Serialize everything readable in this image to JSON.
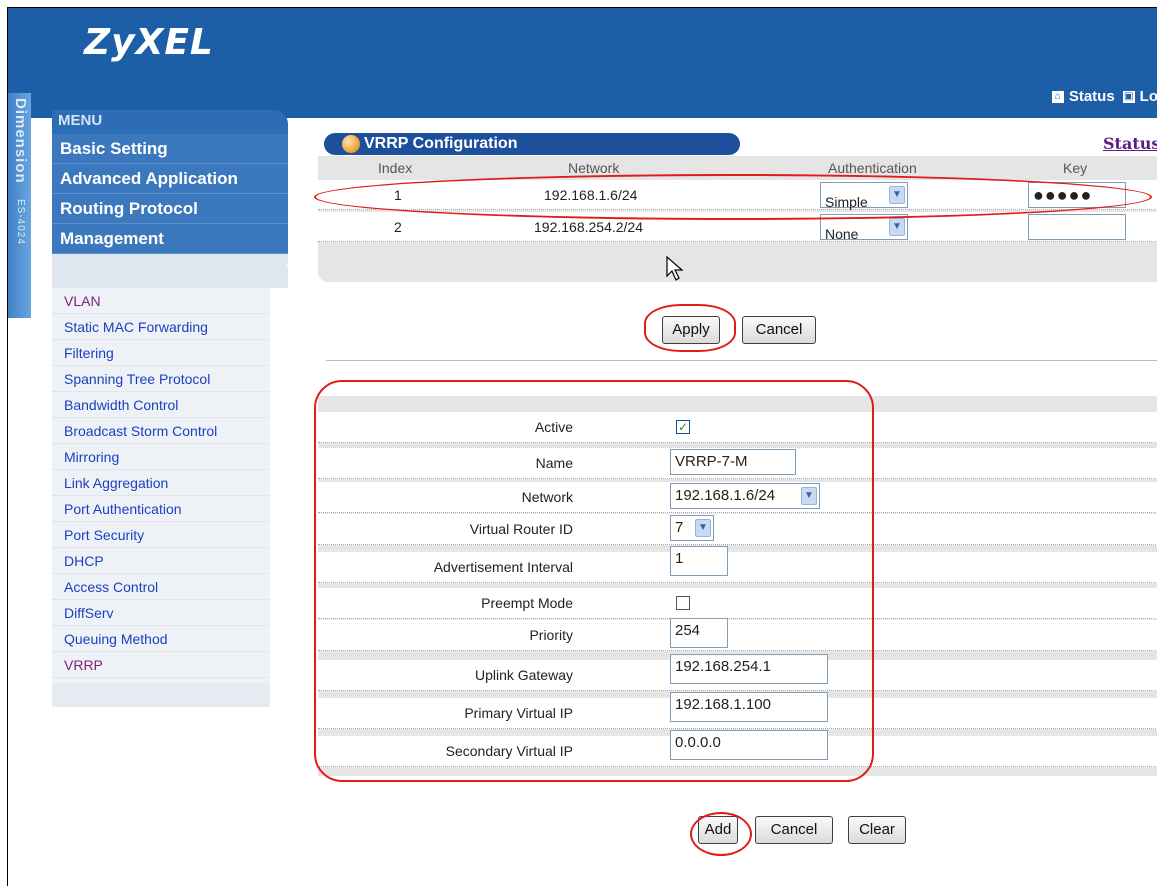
{
  "header": {
    "logo": "ZyXEL",
    "vertical_brand": "Dimension",
    "model": "ES-4024",
    "links": [
      {
        "label": "Status",
        "icon": "home-icon"
      },
      {
        "label": "Lo",
        "icon": "logout-icon"
      }
    ]
  },
  "menu": {
    "title": "MENU",
    "items": [
      {
        "label": "Basic Setting"
      },
      {
        "label": "Advanced Application"
      },
      {
        "label": "Routing Protocol"
      },
      {
        "label": "Management"
      }
    ],
    "sub_items": [
      {
        "label": "VLAN"
      },
      {
        "label": "Static MAC Forwarding"
      },
      {
        "label": "Filtering"
      },
      {
        "label": "Spanning Tree Protocol"
      },
      {
        "label": "Bandwidth Control"
      },
      {
        "label": "Broadcast Storm Control"
      },
      {
        "label": "Mirroring"
      },
      {
        "label": "Link Aggregation"
      },
      {
        "label": "Port Authentication"
      },
      {
        "label": "Port Security"
      },
      {
        "label": "DHCP"
      },
      {
        "label": "Access Control"
      },
      {
        "label": "DiffServ"
      },
      {
        "label": "Queuing Method"
      },
      {
        "label": "VRRP"
      }
    ]
  },
  "section": {
    "title": "VRRP Configuration",
    "status_link": "Status"
  },
  "table": {
    "headers": [
      "Index",
      "Network",
      "Authentication",
      "Key"
    ],
    "rows": [
      {
        "index": "1",
        "network": "192.168.1.6/24",
        "auth": "Simple",
        "key": "●●●●●"
      },
      {
        "index": "2",
        "network": "192.168.254.2/24",
        "auth": "None",
        "key": ""
      }
    ]
  },
  "actions_top": {
    "apply": "Apply",
    "cancel": "Cancel"
  },
  "form": {
    "active_label": "Active",
    "active_checked": true,
    "name_label": "Name",
    "name_value": "VRRP-7-M",
    "network_label": "Network",
    "network_value": "192.168.1.6/24",
    "vrid_label": "Virtual Router ID",
    "vrid_value": "7",
    "adv_label": "Advertisement Interval",
    "adv_value": "1",
    "preempt_label": "Preempt Mode",
    "preempt_checked": false,
    "priority_label": "Priority",
    "priority_value": "254",
    "uplink_label": "Uplink Gateway",
    "uplink_value": "192.168.254.1",
    "primary_label": "Primary Virtual IP",
    "primary_value": "192.168.1.100",
    "secondary_label": "Secondary Virtual IP",
    "secondary_value": "0.0.0.0"
  },
  "actions_bottom": {
    "add": "Add",
    "cancel": "Cancel",
    "clear": "Clear"
  },
  "colors": {
    "brand_blue": "#1c5fa7",
    "annotation_red": "#e11a1a",
    "visited_link": "#7a1f7a",
    "link": "#1a3fbf"
  }
}
